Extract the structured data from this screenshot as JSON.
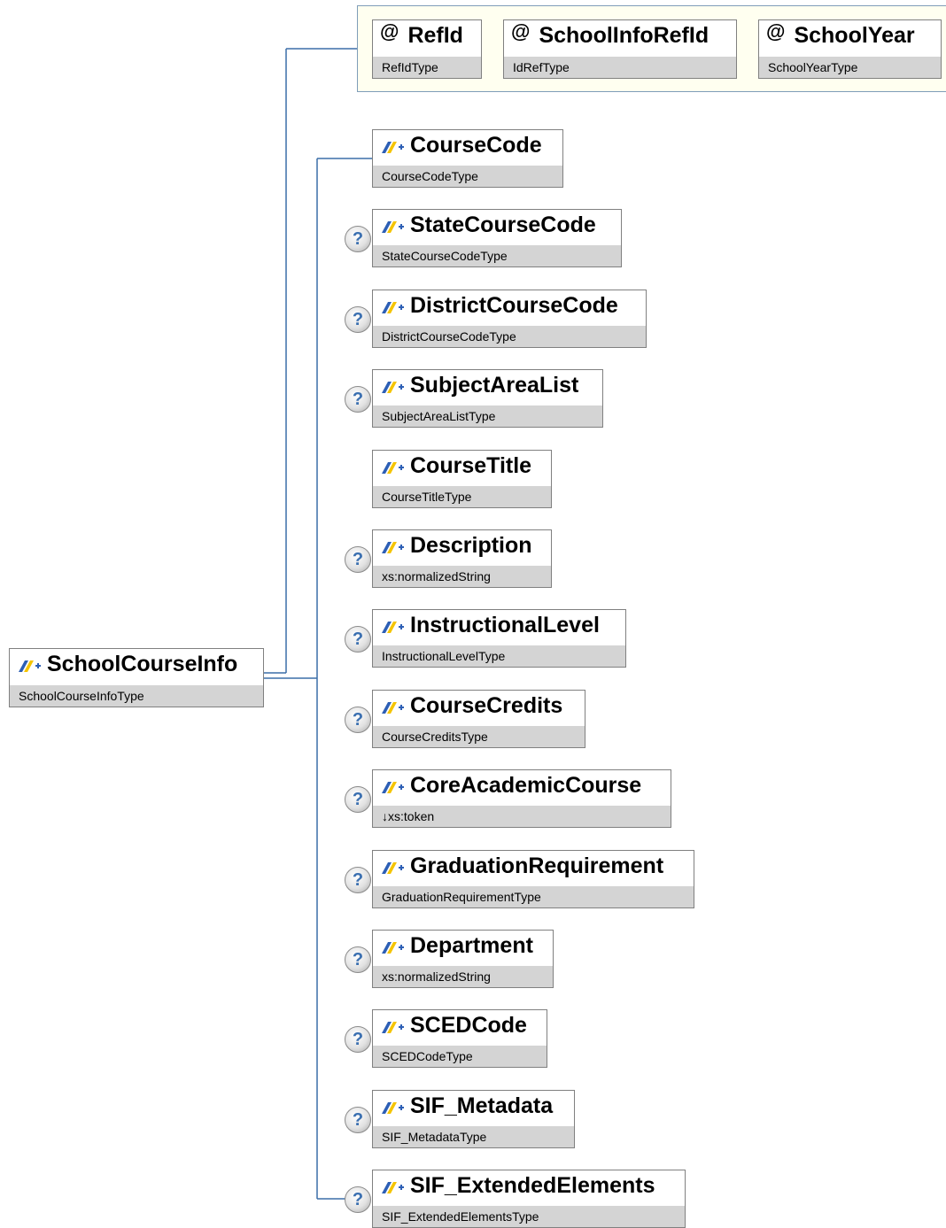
{
  "root": {
    "name": "SchoolCourseInfo",
    "type": "SchoolCourseInfoType"
  },
  "attributes": [
    {
      "name": "RefId",
      "type": "RefIdType"
    },
    {
      "name": "SchoolInfoRefId",
      "type": "IdRefType"
    },
    {
      "name": "SchoolYear",
      "type": "SchoolYearType"
    }
  ],
  "attribute_symbol": "@",
  "optional_symbol": "?",
  "elements": [
    {
      "name": "CourseCode",
      "type": "CourseCodeType",
      "optional": false
    },
    {
      "name": "StateCourseCode",
      "type": "StateCourseCodeType",
      "optional": true
    },
    {
      "name": "DistrictCourseCode",
      "type": "DistrictCourseCodeType",
      "optional": true
    },
    {
      "name": "SubjectAreaList",
      "type": "SubjectAreaListType",
      "optional": true
    },
    {
      "name": "CourseTitle",
      "type": "CourseTitleType",
      "optional": false
    },
    {
      "name": "Description",
      "type": "xs:normalizedString",
      "optional": true
    },
    {
      "name": "InstructionalLevel",
      "type": "InstructionalLevelType",
      "optional": true
    },
    {
      "name": "CourseCredits",
      "type": "CourseCreditsType",
      "optional": true
    },
    {
      "name": "CoreAcademicCourse",
      "type": "↓xs:token",
      "optional": true
    },
    {
      "name": "GraduationRequirement",
      "type": "GraduationRequirementType",
      "optional": true
    },
    {
      "name": "Department",
      "type": "xs:normalizedString",
      "optional": true
    },
    {
      "name": "SCEDCode",
      "type": "SCEDCodeType",
      "optional": true
    },
    {
      "name": "SIF_Metadata",
      "type": "SIF_MetadataType",
      "optional": true
    },
    {
      "name": "SIF_ExtendedElements",
      "type": "SIF_ExtendedElementsType",
      "optional": true
    }
  ],
  "icons": {
    "element": "element-icon",
    "attribute": "at-sign-icon",
    "optional": "question-mark-icon"
  },
  "colors": {
    "connector": "#3c6ea8",
    "type_band": "#d4d4d4",
    "icon_blue": "#2d5fb5",
    "icon_yellow": "#f5c400",
    "group_fill": "#fffff0"
  }
}
